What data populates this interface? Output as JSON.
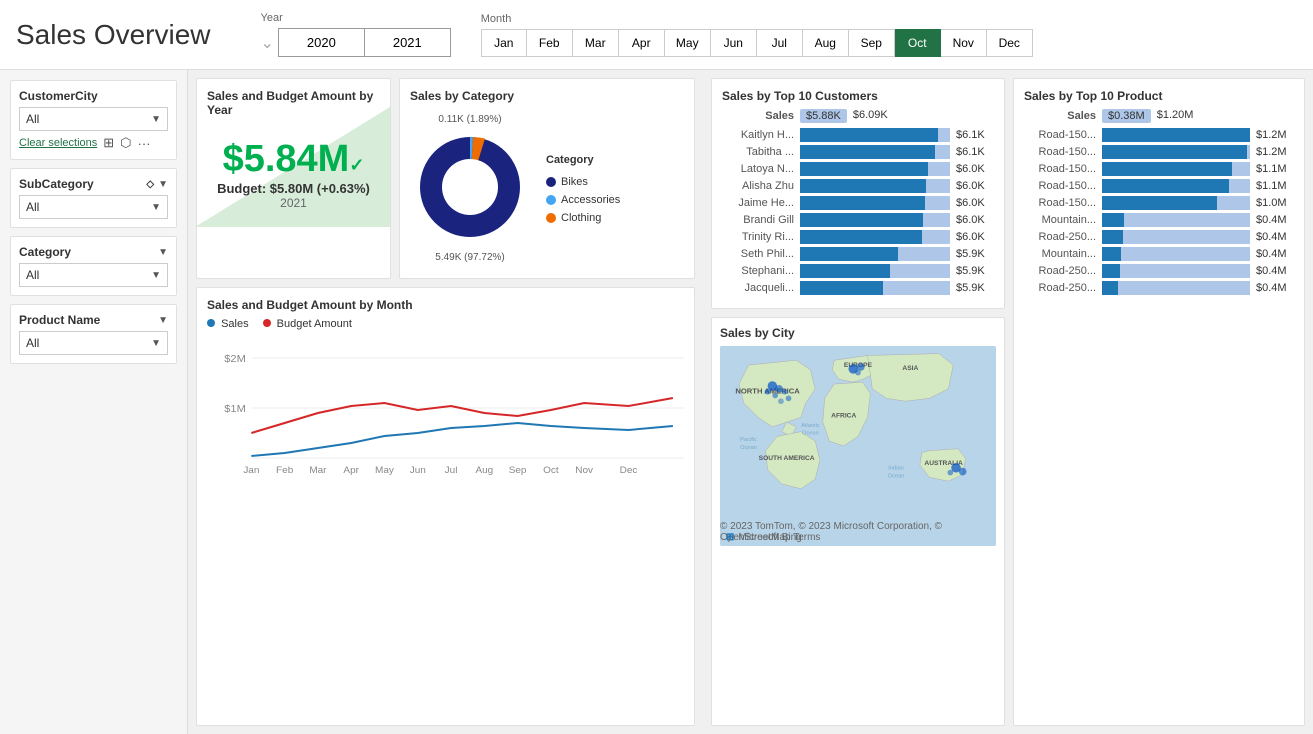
{
  "header": {
    "title": "Sales Overview",
    "year_label": "Year",
    "years": [
      "2020",
      "2021"
    ],
    "month_label": "Month",
    "months": [
      "Jan",
      "Mar",
      "Apr",
      "May",
      "Jun",
      "Jul",
      "Aug",
      "Sep",
      "Oct",
      "Nov",
      "Dec"
    ],
    "months_all": [
      "Jan",
      "Feb",
      "Mar",
      "Apr",
      "May",
      "Jun",
      "Jul",
      "Aug",
      "Sep",
      "Oct",
      "Nov",
      "Dec"
    ],
    "active_month": "Oct"
  },
  "sidebar": {
    "customer_city_label": "CustomerCity",
    "customer_city_value": "All",
    "clear_selections": "Clear selections",
    "subcategory_label": "SubCategory",
    "subcategory_value": "All",
    "category_label": "Category",
    "category_value": "All",
    "product_name_label": "Product Name",
    "product_name_value": "All"
  },
  "summary": {
    "title": "Sales and Budget Amount by Year",
    "amount": "$5.84M",
    "budget": "Budget: $5.80M (+0.63%)",
    "year": "2021"
  },
  "pie": {
    "title": "Sales by Category",
    "top_label": "0.11K (1.89%)",
    "bottom_label": "5.49K (97.72%)",
    "legend": [
      {
        "label": "Bikes",
        "color": "#1a237e"
      },
      {
        "label": "Accessories",
        "color": "#42a5f5"
      },
      {
        "label": "Clothing",
        "color": "#ef6c00"
      }
    ]
  },
  "line_chart": {
    "title": "Sales and Budget Amount by Month",
    "legend": [
      {
        "label": "Sales",
        "color": "#1f77b4"
      },
      {
        "label": "Budget Amount",
        "color": "#d62728"
      }
    ],
    "y_labels": [
      "$2M",
      "$1M"
    ],
    "x_labels": [
      "Jan",
      "Feb",
      "Mar",
      "Apr",
      "May",
      "Jun",
      "Jul",
      "Aug",
      "Sep",
      "Oct",
      "Nov",
      "Dec"
    ]
  },
  "top_customers": {
    "title": "Sales by Top 10 Customers",
    "header_label": "Sales",
    "range_low": "$5.88K",
    "range_high": "$6.09K",
    "customers": [
      {
        "name": "Kaitlyn H...",
        "value": "$6.1K",
        "pct": 92
      },
      {
        "name": "Tabitha ...",
        "value": "$6.1K",
        "pct": 90
      },
      {
        "name": "Latoya N...",
        "value": "$6.0K",
        "pct": 85
      },
      {
        "name": "Alisha Zhu",
        "value": "$6.0K",
        "pct": 84
      },
      {
        "name": "Jaime He...",
        "value": "$6.0K",
        "pct": 83
      },
      {
        "name": "Brandi Gill",
        "value": "$6.0K",
        "pct": 82
      },
      {
        "name": "Trinity Ri...",
        "value": "$6.0K",
        "pct": 81
      },
      {
        "name": "Seth Phil...",
        "value": "$5.9K",
        "pct": 65
      },
      {
        "name": "Stephani...",
        "value": "$5.9K",
        "pct": 60
      },
      {
        "name": "Jacqueli...",
        "value": "$5.9K",
        "pct": 55
      }
    ]
  },
  "top_products": {
    "title": "Sales by Top 10 Product",
    "header_label": "Sales",
    "range_low": "$0.38M",
    "range_high": "$1.20M",
    "products": [
      {
        "name": "Road-150...",
        "value": "$1.2M",
        "pct": 100
      },
      {
        "name": "Road-150...",
        "value": "$1.2M",
        "pct": 98
      },
      {
        "name": "Road-150...",
        "value": "$1.1M",
        "pct": 88
      },
      {
        "name": "Road-150...",
        "value": "$1.1M",
        "pct": 86
      },
      {
        "name": "Road-150...",
        "value": "$1.0M",
        "pct": 78
      },
      {
        "name": "Mountain...",
        "value": "$0.4M",
        "pct": 15
      },
      {
        "name": "Road-250...",
        "value": "$0.4M",
        "pct": 14
      },
      {
        "name": "Mountain...",
        "value": "$0.4M",
        "pct": 13
      },
      {
        "name": "Road-250...",
        "value": "$0.4M",
        "pct": 12
      },
      {
        "name": "Road-250...",
        "value": "$0.4M",
        "pct": 11
      }
    ]
  },
  "map": {
    "title": "Sales by City",
    "labels": [
      "NORTH AMERICA",
      "EUROPE",
      "ASIA",
      "Atlantic Ocean",
      "Pacific Ocean",
      "AFRICA",
      "SOUTH AMERICA",
      "Indian Ocean",
      "AUSTRALIA"
    ],
    "bing_label": "Microsoft Bing",
    "copyright": "© 2023 TomTom, © 2023 Microsoft Corporation, © OpenStreetMap  Terms"
  }
}
